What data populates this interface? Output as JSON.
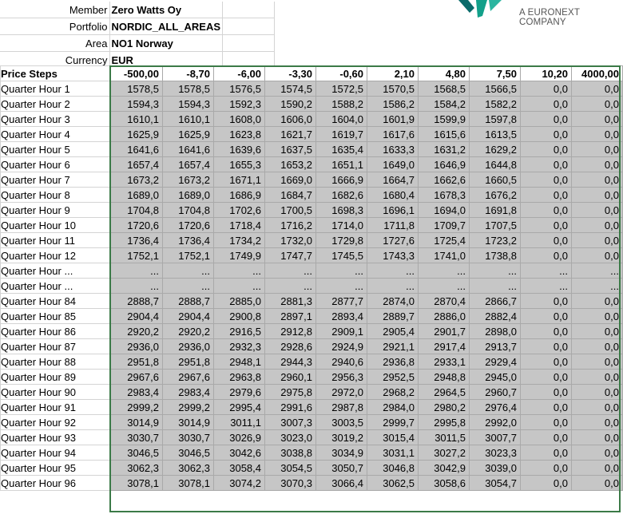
{
  "meta": {
    "member_label": "Member",
    "member_value": "Zero Watts Oy",
    "portfolio_label": "Portfolio",
    "portfolio_value": "NORDIC_ALL_AREAS",
    "area_label": "Area",
    "area_value": "NO1 Norway",
    "currency_label": "Currency",
    "currency_value": "EUR"
  },
  "brand": {
    "tagline": "A EURONEXT COMPANY",
    "logo_colors": [
      "#0a6b6b",
      "#12a08a",
      "#2bb5a0"
    ]
  },
  "table": {
    "row_header": "Price Steps",
    "price_steps": [
      "-500,00",
      "-8,70",
      "-6,00",
      "-3,30",
      "-0,60",
      "2,10",
      "4,80",
      "7,50",
      "10,20",
      "4000,00"
    ],
    "rows": [
      {
        "label": "Quarter Hour 1",
        "values": [
          "1578,5",
          "1578,5",
          "1576,5",
          "1574,5",
          "1572,5",
          "1570,5",
          "1568,5",
          "1566,5",
          "0,0",
          "0,0"
        ]
      },
      {
        "label": "Quarter Hour 2",
        "values": [
          "1594,3",
          "1594,3",
          "1592,3",
          "1590,2",
          "1588,2",
          "1586,2",
          "1584,2",
          "1582,2",
          "0,0",
          "0,0"
        ]
      },
      {
        "label": "Quarter Hour 3",
        "values": [
          "1610,1",
          "1610,1",
          "1608,0",
          "1606,0",
          "1604,0",
          "1601,9",
          "1599,9",
          "1597,8",
          "0,0",
          "0,0"
        ]
      },
      {
        "label": "Quarter Hour 4",
        "values": [
          "1625,9",
          "1625,9",
          "1623,8",
          "1621,7",
          "1619,7",
          "1617,6",
          "1615,6",
          "1613,5",
          "0,0",
          "0,0"
        ]
      },
      {
        "label": "Quarter Hour 5",
        "values": [
          "1641,6",
          "1641,6",
          "1639,6",
          "1637,5",
          "1635,4",
          "1633,3",
          "1631,2",
          "1629,2",
          "0,0",
          "0,0"
        ]
      },
      {
        "label": "Quarter Hour 6",
        "values": [
          "1657,4",
          "1657,4",
          "1655,3",
          "1653,2",
          "1651,1",
          "1649,0",
          "1646,9",
          "1644,8",
          "0,0",
          "0,0"
        ]
      },
      {
        "label": "Quarter Hour 7",
        "values": [
          "1673,2",
          "1673,2",
          "1671,1",
          "1669,0",
          "1666,9",
          "1664,7",
          "1662,6",
          "1660,5",
          "0,0",
          "0,0"
        ]
      },
      {
        "label": "Quarter Hour 8",
        "values": [
          "1689,0",
          "1689,0",
          "1686,9",
          "1684,7",
          "1682,6",
          "1680,4",
          "1678,3",
          "1676,2",
          "0,0",
          "0,0"
        ]
      },
      {
        "label": "Quarter Hour 9",
        "values": [
          "1704,8",
          "1704,8",
          "1702,6",
          "1700,5",
          "1698,3",
          "1696,1",
          "1694,0",
          "1691,8",
          "0,0",
          "0,0"
        ]
      },
      {
        "label": "Quarter Hour 10",
        "values": [
          "1720,6",
          "1720,6",
          "1718,4",
          "1716,2",
          "1714,0",
          "1711,8",
          "1709,7",
          "1707,5",
          "0,0",
          "0,0"
        ]
      },
      {
        "label": "Quarter Hour 11",
        "values": [
          "1736,4",
          "1736,4",
          "1734,2",
          "1732,0",
          "1729,8",
          "1727,6",
          "1725,4",
          "1723,2",
          "0,0",
          "0,0"
        ]
      },
      {
        "label": "Quarter Hour 12",
        "values": [
          "1752,1",
          "1752,1",
          "1749,9",
          "1747,7",
          "1745,5",
          "1743,3",
          "1741,0",
          "1738,8",
          "0,0",
          "0,0"
        ]
      },
      {
        "label": "Quarter Hour ...",
        "values": [
          "...",
          "...",
          "...",
          "...",
          "...",
          "...",
          "...",
          "...",
          "...",
          "..."
        ]
      },
      {
        "label": "Quarter Hour ...",
        "values": [
          "...",
          "...",
          "...",
          "...",
          "...",
          "...",
          "...",
          "...",
          "...",
          "..."
        ]
      },
      {
        "label": "Quarter Hour 84",
        "values": [
          "2888,7",
          "2888,7",
          "2885,0",
          "2881,3",
          "2877,7",
          "2874,0",
          "2870,4",
          "2866,7",
          "0,0",
          "0,0"
        ]
      },
      {
        "label": "Quarter Hour 85",
        "values": [
          "2904,4",
          "2904,4",
          "2900,8",
          "2897,1",
          "2893,4",
          "2889,7",
          "2886,0",
          "2882,4",
          "0,0",
          "0,0"
        ]
      },
      {
        "label": "Quarter Hour 86",
        "values": [
          "2920,2",
          "2920,2",
          "2916,5",
          "2912,8",
          "2909,1",
          "2905,4",
          "2901,7",
          "2898,0",
          "0,0",
          "0,0"
        ]
      },
      {
        "label": "Quarter Hour 87",
        "values": [
          "2936,0",
          "2936,0",
          "2932,3",
          "2928,6",
          "2924,9",
          "2921,1",
          "2917,4",
          "2913,7",
          "0,0",
          "0,0"
        ]
      },
      {
        "label": "Quarter Hour 88",
        "values": [
          "2951,8",
          "2951,8",
          "2948,1",
          "2944,3",
          "2940,6",
          "2936,8",
          "2933,1",
          "2929,4",
          "0,0",
          "0,0"
        ]
      },
      {
        "label": "Quarter Hour 89",
        "values": [
          "2967,6",
          "2967,6",
          "2963,8",
          "2960,1",
          "2956,3",
          "2952,5",
          "2948,8",
          "2945,0",
          "0,0",
          "0,0"
        ]
      },
      {
        "label": "Quarter Hour 90",
        "values": [
          "2983,4",
          "2983,4",
          "2979,6",
          "2975,8",
          "2972,0",
          "2968,2",
          "2964,5",
          "2960,7",
          "0,0",
          "0,0"
        ]
      },
      {
        "label": "Quarter Hour 91",
        "values": [
          "2999,2",
          "2999,2",
          "2995,4",
          "2991,6",
          "2987,8",
          "2984,0",
          "2980,2",
          "2976,4",
          "0,0",
          "0,0"
        ]
      },
      {
        "label": "Quarter Hour 92",
        "values": [
          "3014,9",
          "3014,9",
          "3011,1",
          "3007,3",
          "3003,5",
          "2999,7",
          "2995,8",
          "2992,0",
          "0,0",
          "0,0"
        ]
      },
      {
        "label": "Quarter Hour 93",
        "values": [
          "3030,7",
          "3030,7",
          "3026,9",
          "3023,0",
          "3019,2",
          "3015,4",
          "3011,5",
          "3007,7",
          "0,0",
          "0,0"
        ]
      },
      {
        "label": "Quarter Hour 94",
        "values": [
          "3046,5",
          "3046,5",
          "3042,6",
          "3038,8",
          "3034,9",
          "3031,1",
          "3027,2",
          "3023,3",
          "0,0",
          "0,0"
        ]
      },
      {
        "label": "Quarter Hour 95",
        "values": [
          "3062,3",
          "3062,3",
          "3058,4",
          "3054,5",
          "3050,7",
          "3046,8",
          "3042,9",
          "3039,0",
          "0,0",
          "0,0"
        ]
      },
      {
        "label": "Quarter Hour 96",
        "values": [
          "3078,1",
          "3078,1",
          "3074,2",
          "3070,3",
          "3066,4",
          "3062,5",
          "3058,6",
          "3054,7",
          "0,0",
          "0,0"
        ]
      }
    ]
  }
}
